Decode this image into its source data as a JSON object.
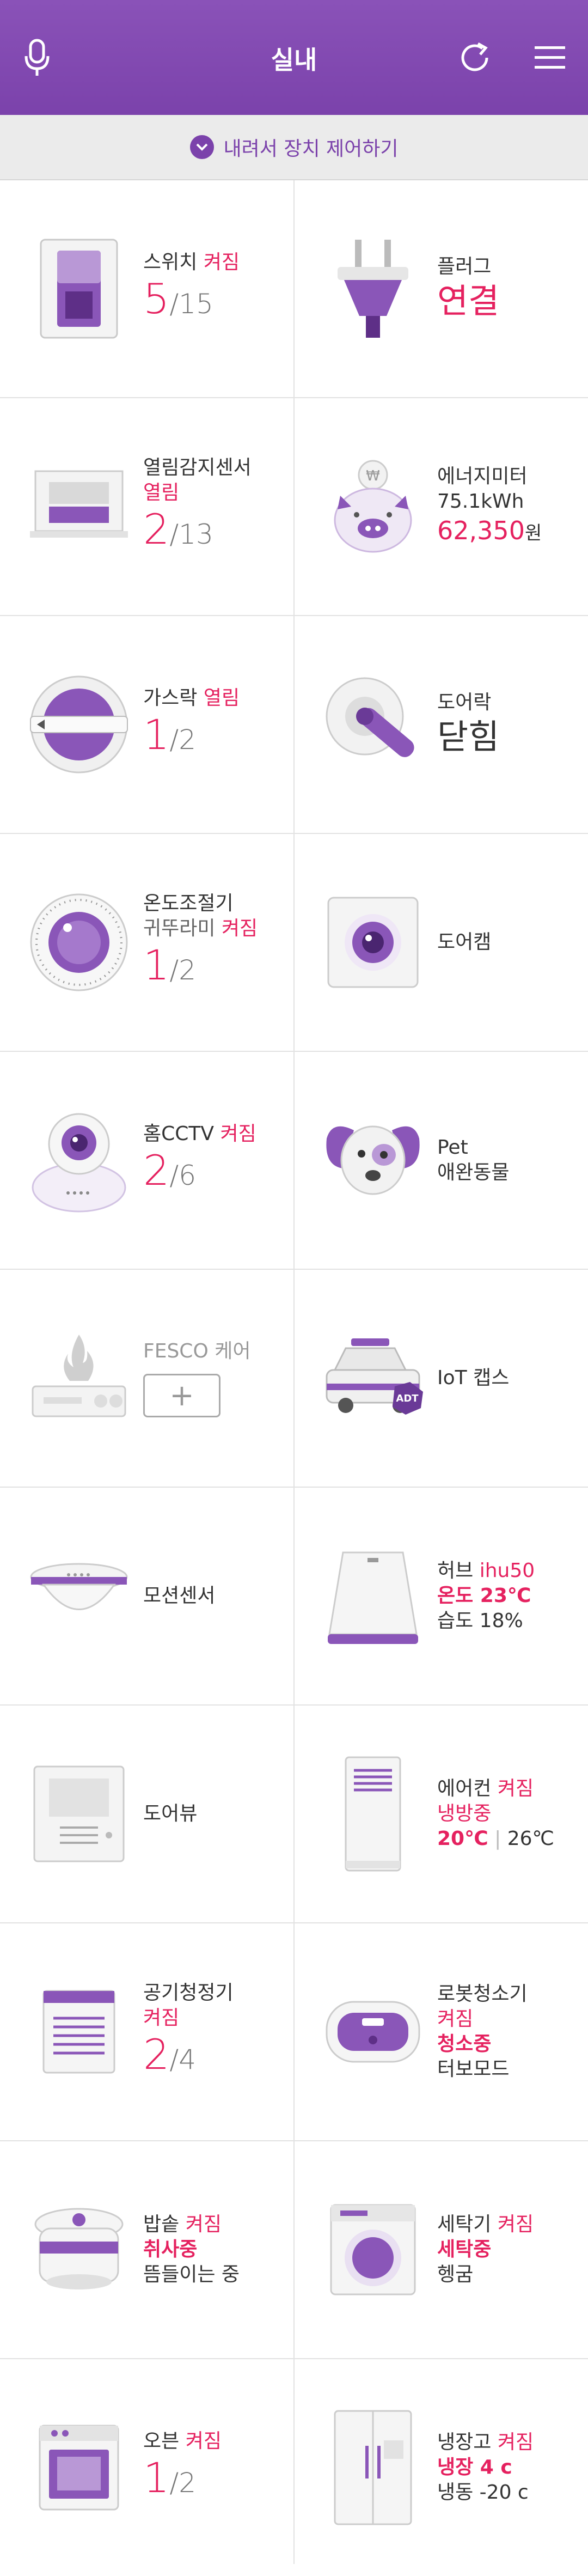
{
  "header": {
    "title": "실내",
    "mic_icon": "mic-icon",
    "refresh_icon": "refresh-icon",
    "menu_icon": "hamburger-menu-icon"
  },
  "banner": {
    "label": "내려서 장치 제어하기",
    "icon": "chevron-down-icon"
  },
  "colors": {
    "brand": "#7b42ab",
    "accent": "#e5215f"
  },
  "devices": {
    "switch": {
      "name": "스위치",
      "status": "켜짐",
      "count": "5",
      "total": "/15"
    },
    "plug": {
      "name": "플러그",
      "status": "연결"
    },
    "open_sensor": {
      "name": "열림감지센서",
      "status": "열림",
      "count": "2",
      "total": "/13"
    },
    "energy": {
      "name": "에너지미터",
      "usage": "75.1kWh",
      "amount": "62,350",
      "unit": "원"
    },
    "gas": {
      "name": "가스락",
      "status": "열림",
      "count": "1",
      "total": "/2"
    },
    "doorlock": {
      "name": "도어락",
      "status": "닫힘"
    },
    "thermostat": {
      "name": "온도조절기",
      "sub": "귀뚜라미",
      "status": "켜짐",
      "count": "1",
      "total": "/2"
    },
    "doorcam": {
      "name": "도어캠"
    },
    "cctv": {
      "name": "홈CCTV",
      "status": "켜짐",
      "count": "2",
      "total": "/6"
    },
    "pet": {
      "name": "Pet",
      "sub": "애완동물"
    },
    "fesco": {
      "name": "FESCO 케어",
      "add": "+"
    },
    "iotcaps": {
      "name": "IoT 캡스",
      "badge": "ADT"
    },
    "motion": {
      "name": "모션센서"
    },
    "hub": {
      "name": "허브",
      "model": "ihu50",
      "temp": "온도 23℃",
      "humidity": "습도 18%"
    },
    "doorview": {
      "name": "도어뷰"
    },
    "aircon": {
      "name": "에어컨",
      "status": "켜짐",
      "mode": "냉방중",
      "target": "20℃",
      "current": "26℃"
    },
    "purifier": {
      "name": "공기청정기",
      "status": "켜짐",
      "count": "2",
      "total": "/4"
    },
    "robot": {
      "name": "로봇청소기",
      "status": "켜짐",
      "mode": "청소중",
      "sub": "터보모드"
    },
    "ricecooker": {
      "name": "밥솥",
      "status": "켜짐",
      "mode": "취사중",
      "sub": "뜸들이는 중"
    },
    "washer": {
      "name": "세탁기",
      "status": "켜짐",
      "mode": "세탁중",
      "sub": "헹굼"
    },
    "oven": {
      "name": "오븐",
      "status": "켜짐",
      "count": "1",
      "total": "/2"
    },
    "fridge": {
      "name": "냉장고",
      "status": "켜짐",
      "fridge": "냉장 4 c",
      "freezer": "냉동 -20 c"
    }
  }
}
